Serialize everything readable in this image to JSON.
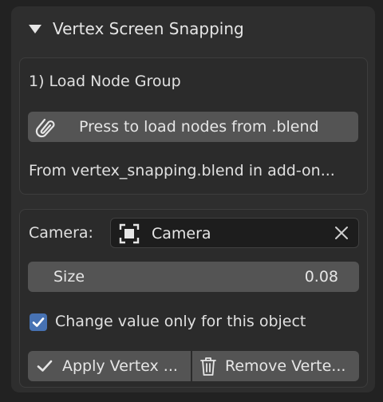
{
  "panel": {
    "title": "Vertex Screen Snapping",
    "expanded": true
  },
  "load_section": {
    "heading": "1) Load Node Group",
    "load_button_label": "Press to load nodes from .blend",
    "info_text": "From vertex_snapping.blend in add-on..."
  },
  "settings": {
    "camera_label": "Camera:",
    "camera_value": "Camera",
    "size_label": "Size",
    "size_value": "0.08",
    "checkbox_label": "Change value only for this object",
    "checkbox_checked": true,
    "apply_label": "Apply Vertex ...",
    "remove_label": "Remove Verte..."
  },
  "icons": {
    "caret": "disclosure-triangle-down-icon",
    "load": "paperclip-icon",
    "camera": "camera-object-icon",
    "clear": "close-x-icon",
    "check": "checkmark-icon",
    "apply": "checkmark-icon",
    "remove": "trash-icon"
  },
  "colors": {
    "accent": "#4772b3",
    "button": "#545454",
    "panel": "#2e2e2e",
    "field": "#1d1d1d"
  }
}
